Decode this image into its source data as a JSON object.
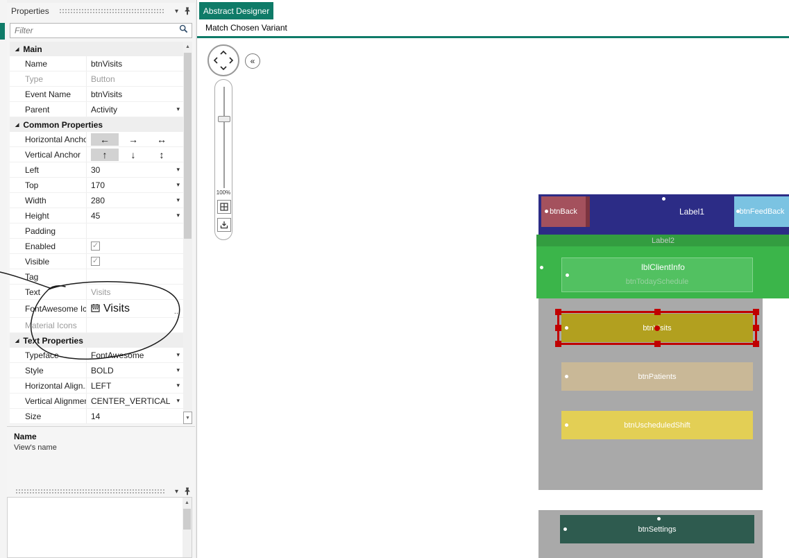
{
  "icons": {
    "panel_chevron": "▾",
    "dropdown": "▾",
    "section_expanded": "◢",
    "check": "✓",
    "scroll_up": "▲",
    "scroll_down": "▼",
    "collapse_double": "«",
    "ellipsis": "..."
  },
  "anchors": {
    "left": "←",
    "right": "→",
    "horizontal": "↔",
    "up": "↑",
    "down": "↓",
    "vertical": "↕"
  },
  "props": {
    "title": "Properties",
    "filter_placeholder": "Filter",
    "section_main": "Main",
    "section_common": "Common Properties",
    "section_text": "Text Properties",
    "rows": {
      "name": {
        "label": "Name",
        "value": "btnVisits"
      },
      "type": {
        "label": "Type",
        "value": "Button"
      },
      "event_name": {
        "label": "Event Name",
        "value": "btnVisits"
      },
      "parent": {
        "label": "Parent",
        "value": "Activity"
      },
      "h_anchor": {
        "label": "Horizontal Anchor"
      },
      "v_anchor": {
        "label": "Vertical Anchor"
      },
      "left": {
        "label": "Left",
        "value": "30"
      },
      "top": {
        "label": "Top",
        "value": "170"
      },
      "width": {
        "label": "Width",
        "value": "280"
      },
      "height": {
        "label": "Height",
        "value": "45"
      },
      "padding": {
        "label": "Padding",
        "value": ""
      },
      "enabled": {
        "label": "Enabled"
      },
      "visible": {
        "label": "Visible"
      },
      "tag": {
        "label": "Tag",
        "value": ""
      },
      "text": {
        "label": "Text",
        "value": "Visits"
      },
      "fontawesome": {
        "label": "FontAwesome Ic...",
        "value": "Visits"
      },
      "material": {
        "label": "Material Icons",
        "value": ""
      },
      "typeface": {
        "label": "Typeface",
        "value": "FontAwesome"
      },
      "style": {
        "label": "Style",
        "value": "BOLD"
      },
      "h_align": {
        "label": "Horizontal Align...",
        "value": "LEFT"
      },
      "v_align": {
        "label": "Vertical Alignment",
        "value": "CENTER_VERTICAL"
      },
      "size": {
        "label": "Size",
        "value": "14"
      }
    },
    "footer": {
      "title": "Name",
      "description": "View's name"
    }
  },
  "designer": {
    "tab": "Abstract Designer",
    "toolbar": "Match Chosen Variant",
    "zoom": "100%"
  },
  "canvas": {
    "btn_back": "btnBack",
    "label1": "Label1",
    "btn_feedback": "btnFeedBack",
    "label2": "Label2",
    "lbl_client_info": "lblClientInfo",
    "btn_today_schedule": "btnTodaySchedule",
    "btn_visits": "btnVisits",
    "btn_patients": "btnPatients",
    "btn_unscheduled": "btnUscheduledShift",
    "btn_settings": "btnSettings"
  },
  "colors": {
    "accent_teal": "#0f7b68",
    "navy_bar": "#2c2c86",
    "back_button": "#a4515d",
    "feedback_button": "#7bc3e2",
    "green_panel": "#3bb54a",
    "today_button": "#52c161",
    "gray_panel": "#a9a9a9",
    "visits_button": "#b2a01f",
    "patients_button": "#c9b897",
    "unscheduled_button": "#e3cf55",
    "settings_button": "#2e5b4f",
    "selection_red": "#c00000"
  }
}
